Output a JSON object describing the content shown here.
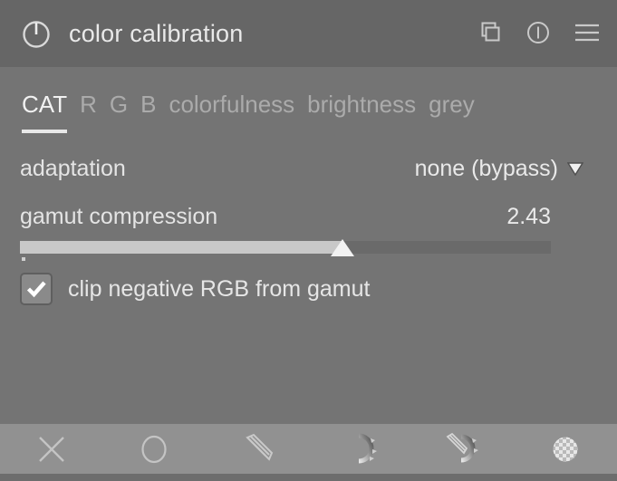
{
  "header": {
    "title": "color calibration",
    "power_icon": "power-icon",
    "actions": [
      {
        "name": "duplicate-instance-button",
        "icon": "multi-instance-icon"
      },
      {
        "name": "reset-parameters-button",
        "icon": "reset-circle-icon"
      },
      {
        "name": "presets-menu-button",
        "icon": "hamburger-menu-icon"
      }
    ]
  },
  "tabs": {
    "items": [
      {
        "label": "CAT",
        "active": true
      },
      {
        "label": "R",
        "active": false
      },
      {
        "label": "G",
        "active": false
      },
      {
        "label": "B",
        "active": false
      },
      {
        "label": "colorfulness",
        "active": false
      },
      {
        "label": "brightness",
        "active": false
      },
      {
        "label": "grey",
        "active": false
      }
    ]
  },
  "controls": {
    "adaptation": {
      "label": "adaptation",
      "value": "none (bypass)",
      "arrow_icon": "chevron-down-icon"
    },
    "gamut_compression": {
      "label": "gamut compression",
      "value": "2.43",
      "fill_percent": 60.7
    },
    "clip_negative": {
      "label": "clip negative RGB from gamut",
      "checked": true
    }
  },
  "toolbar": {
    "items": [
      {
        "name": "mask-off-button",
        "icon": "x-icon"
      },
      {
        "name": "uniformly-mask-button",
        "icon": "circle-icon"
      },
      {
        "name": "drawn-mask-button",
        "icon": "pencil-icon"
      },
      {
        "name": "parametric-mask-button",
        "icon": "gradient-arc-icon"
      },
      {
        "name": "drawn-and-parametric-mask-button",
        "icon": "pencil-arc-icon"
      },
      {
        "name": "raster-mask-button",
        "icon": "checkerboard-circle-icon"
      }
    ]
  },
  "colors": {
    "panel_bg": "#747474",
    "header_bg": "#666666",
    "toolbar_bg": "#919191",
    "text": "#e6e6e6",
    "text_dim": "#ababab",
    "slider_fill": "#c8c8c8",
    "slider_track": "#6a6a6a"
  }
}
